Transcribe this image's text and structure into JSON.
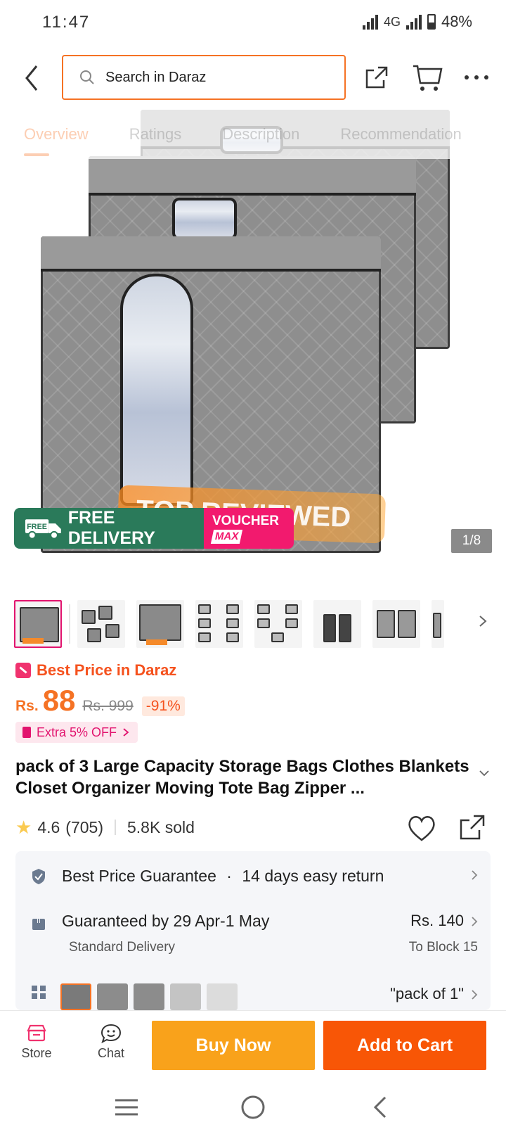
{
  "status_bar": {
    "time": "11:47",
    "network": "4G",
    "battery": "48%"
  },
  "header": {
    "search_placeholder": "Search in Daraz"
  },
  "tabs": [
    "Overview",
    "Ratings",
    "Description",
    "Recommendation"
  ],
  "hero": {
    "overlay_text": "TOP REVIEWED",
    "free_delivery": "FREE DELIVERY",
    "free_tag": "FREE",
    "voucher_line1": "VOUCHER",
    "voucher_line2": "MAX",
    "counter": "1/8"
  },
  "thumbnails": {
    "count": 8,
    "selected": 0
  },
  "pricing": {
    "best_price_label": "Best Price in Daraz",
    "currency": "Rs.",
    "price": "88",
    "original_price": "Rs. 999",
    "discount": "-91%",
    "extra_offer": "Extra 5% OFF",
    "accent_color": "#f57224"
  },
  "product": {
    "title": "pack of 3 Large Capacity Storage Bags Clothes Blankets Closet Organizer Moving Tote Bag Zipper ...",
    "rating": "4.6",
    "reviews": "(705)",
    "sold": "5.8K sold"
  },
  "info": {
    "guarantee": "Best Price Guarantee",
    "dot": "·",
    "returns": "14 days easy return",
    "delivery_title": "Guaranteed by 29 Apr-1 May",
    "delivery_type": "Standard Delivery",
    "delivery_price": "Rs. 140",
    "delivery_location": "To Block 15",
    "variant": "\"pack of 1\""
  },
  "actions": {
    "store": "Store",
    "chat": "Chat",
    "buy_now": "Buy Now",
    "add_to_cart": "Add to Cart",
    "buy_color": "#f9a21b",
    "cart_color": "#f85606"
  }
}
